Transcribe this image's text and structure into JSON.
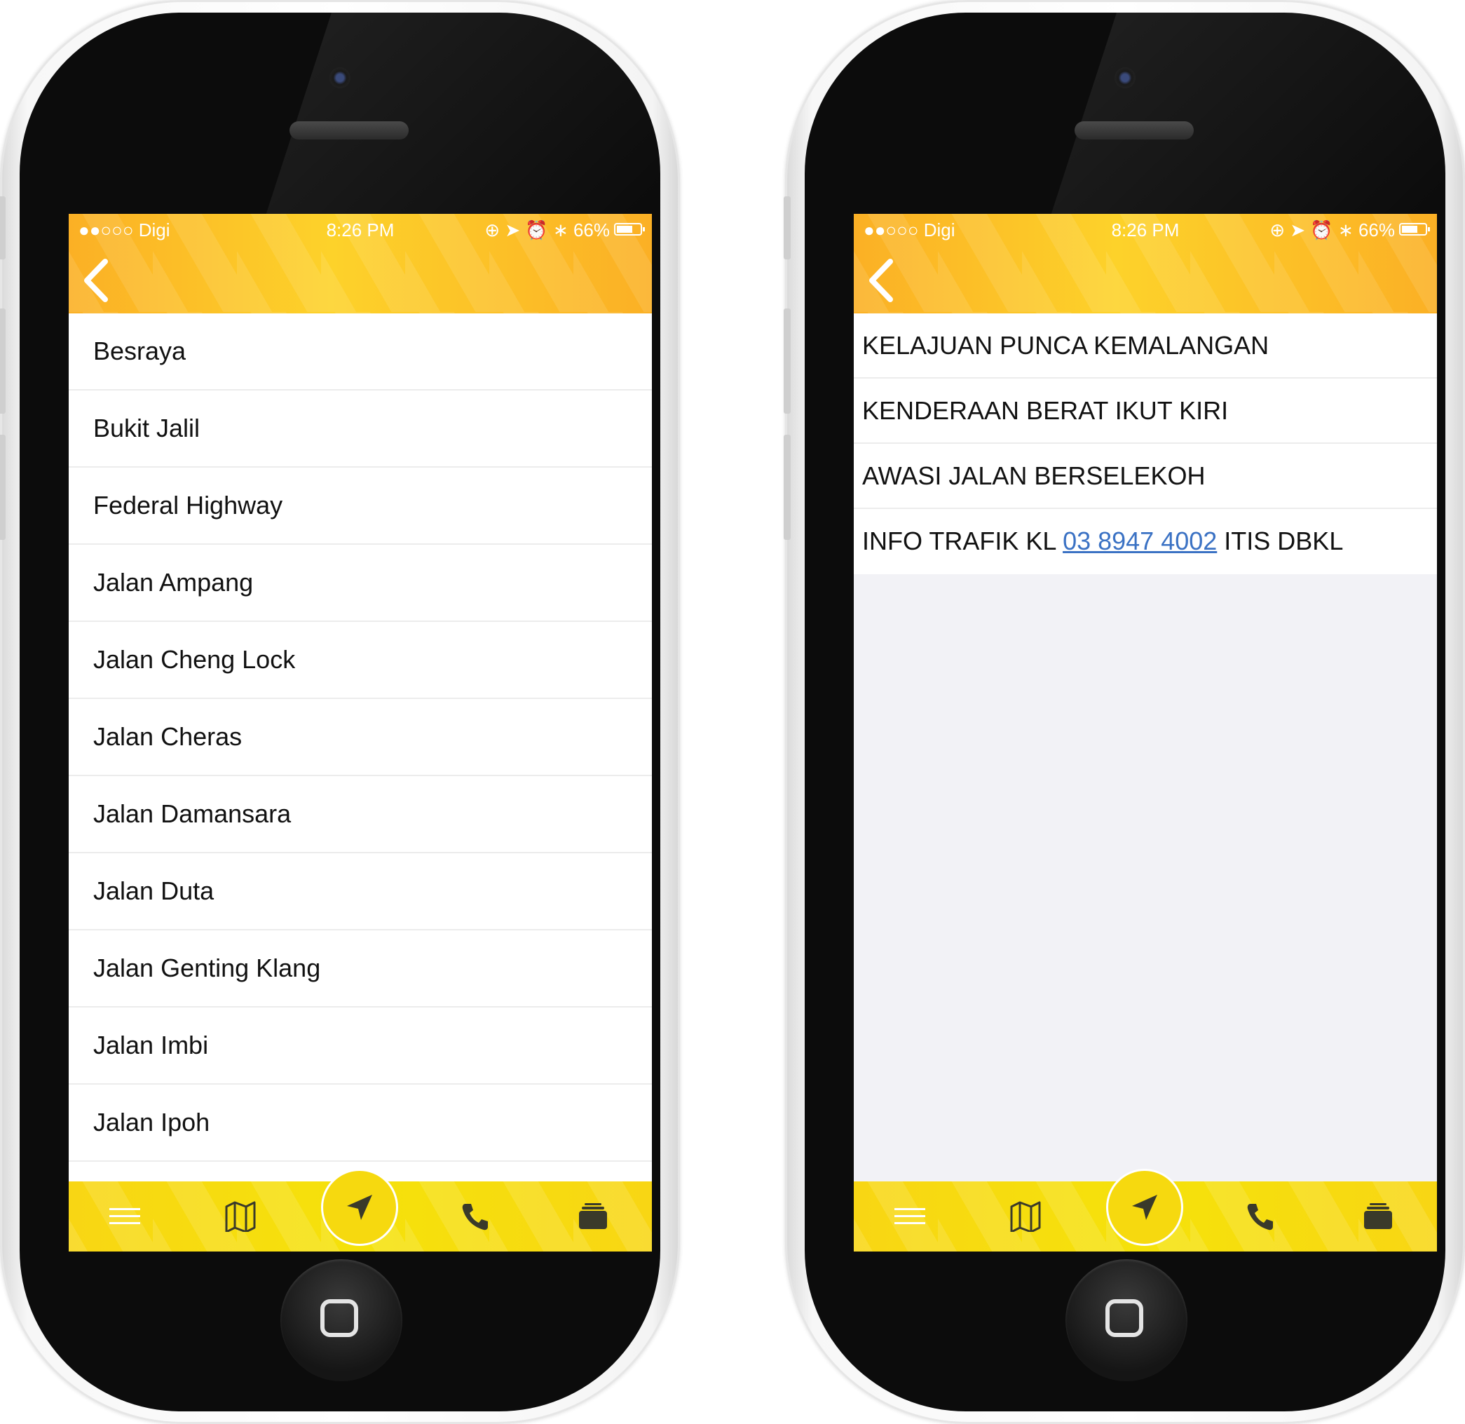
{
  "status_bar": {
    "carrier": "●●○○○ Digi",
    "time": "8:26 PM",
    "right": "66%"
  },
  "left_screen": {
    "roads": [
      "Besraya",
      "Bukit Jalil",
      "Federal Highway",
      "Jalan Ampang",
      "Jalan Cheng Lock",
      "Jalan Cheras",
      "Jalan Damansara",
      "Jalan Duta",
      "Jalan Genting Klang",
      "Jalan Imbi",
      "Jalan Ipoh"
    ]
  },
  "right_screen": {
    "notices": [
      "KELAJUAN PUNCA KEMALANGAN",
      "KENDERAAN BERAT IKUT KIRI",
      "AWASI JALAN BERSELEKOH"
    ],
    "info_prefix": "INFO TRAFIK KL ",
    "info_phone": "03 8947 4002",
    "info_suffix": " ITIS DBKL"
  },
  "tabbar": {
    "icons": [
      "menu-icon",
      "map-icon",
      "navigation-icon",
      "phone-icon",
      "briefcase-icon"
    ]
  },
  "colors": {
    "header_orange": "#fbb025",
    "header_yellow": "#fdd22a",
    "tabbar_yellow": "#f5e20a",
    "link_blue": "#3b72c4"
  }
}
